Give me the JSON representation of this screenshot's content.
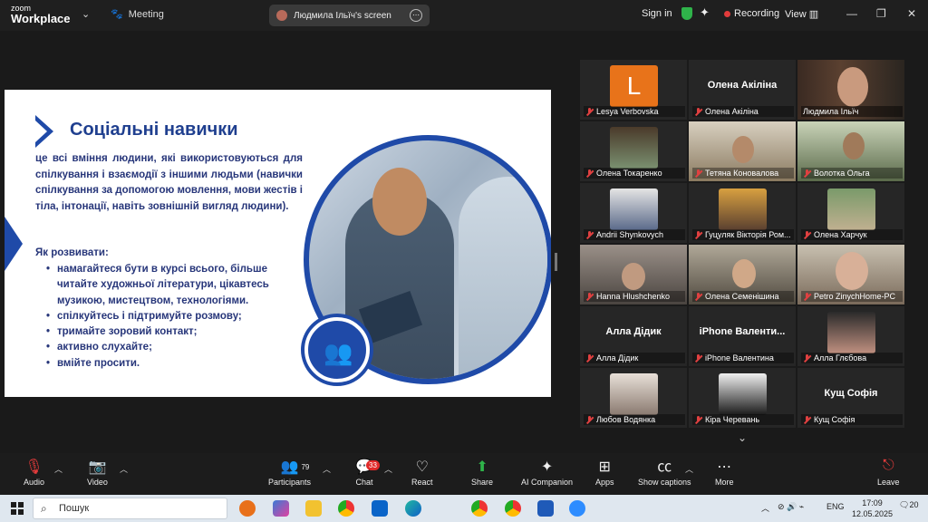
{
  "app": {
    "logo_top": "zoom",
    "logo_bottom": "Workplace",
    "meeting_label": "Meeting"
  },
  "screen_share": {
    "label": "Людмила Ільїч's screen"
  },
  "header": {
    "sign_in": "Sign in",
    "recording": "Recording",
    "view": "View"
  },
  "slide": {
    "title": "Соціальні навички",
    "intro": "це всі вміння людини, які використовуються для спілкування і взаємодії з іншими людьми (навички спілкування за допомогою мовлення, мови жестів і тіла, інтонації, навіть зовнішній вигляд людини).",
    "how_label": "Як розвивати:",
    "bullets": [
      "намагайтеся бути в курсі всього, більше читайте художньої літератури, цікавтесь музикою, мистецтвом, технологіями.",
      "спілкуйтесь і підтримуйте розмову;",
      "тримайте зоровий контакт;",
      "активно слухайте;",
      "вмійте просити."
    ]
  },
  "participants_grid": [
    {
      "name": "Lesya Verbovska",
      "initial": "L"
    },
    {
      "name": "Олена Акіліна",
      "big": "Олена Акіліна"
    },
    {
      "name": "Людмила Ільїч",
      "active": true
    },
    {
      "name": "Олена Токаренко"
    },
    {
      "name": "Тетяна Коновалова"
    },
    {
      "name": "Волотка Ольга"
    },
    {
      "name": "Andrii Shynkovych"
    },
    {
      "name": "Гуцуляк Вікторія Ром..."
    },
    {
      "name": "Олена Харчук"
    },
    {
      "name": "Hanna Hlushchenko"
    },
    {
      "name": "Олена Семенішина"
    },
    {
      "name": "Petro ZinychHome-PC"
    },
    {
      "name": "Алла Дідик",
      "big": "Алла Дідик"
    },
    {
      "name": "iPhone Валентина",
      "big": "iPhone  Валенти..."
    },
    {
      "name": "Алла Глєбова"
    },
    {
      "name": "Любов Водянка"
    },
    {
      "name": "Кіра Черевань"
    },
    {
      "name": "Кущ Софія",
      "big": "Кущ Софія"
    }
  ],
  "toolbar": {
    "audio": "Audio",
    "video": "Video",
    "participants": "Participants",
    "participants_count": "79",
    "chat": "Chat",
    "chat_badge": "33",
    "react": "React",
    "share": "Share",
    "ai_companion": "AI Companion",
    "apps": "Apps",
    "captions": "Show captions",
    "more": "More",
    "leave": "Leave"
  },
  "taskbar": {
    "search_placeholder": "Пошук",
    "lang": "ENG",
    "time": "17:09",
    "date": "12.05.2025",
    "notifications": "20"
  },
  "colors": {
    "accent": "#1f4aa8",
    "active_speaker": "#3ac24a",
    "leave": "#e23b3b"
  }
}
